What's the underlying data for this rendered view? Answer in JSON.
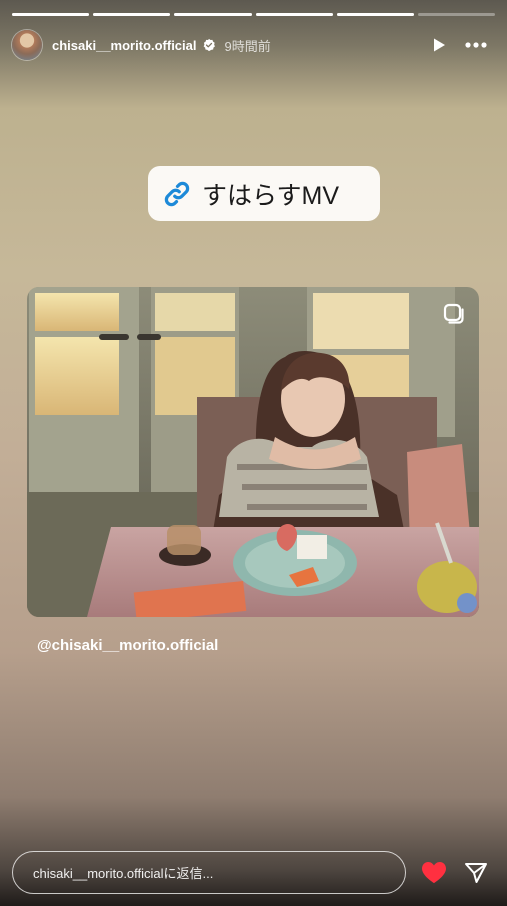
{
  "progress": {
    "segments": [
      1,
      1,
      1,
      1,
      1,
      0
    ]
  },
  "header": {
    "username": "chisaki__morito.official",
    "time": "9時間前",
    "verified": true,
    "icons": [
      "play-icon",
      "more-icon"
    ]
  },
  "link_sticker": {
    "label": "すはらすMV",
    "icon": "link-icon",
    "icon_color": "#1d8ad8"
  },
  "post": {
    "mention": "@chisaki__morito.official",
    "icon": "multi-photo-icon"
  },
  "footer": {
    "reply_placeholder": "chisaki__morito.officialに返信...",
    "like_icon": "heart-icon",
    "like_color": "#ff3040",
    "share_icon": "send-icon"
  }
}
